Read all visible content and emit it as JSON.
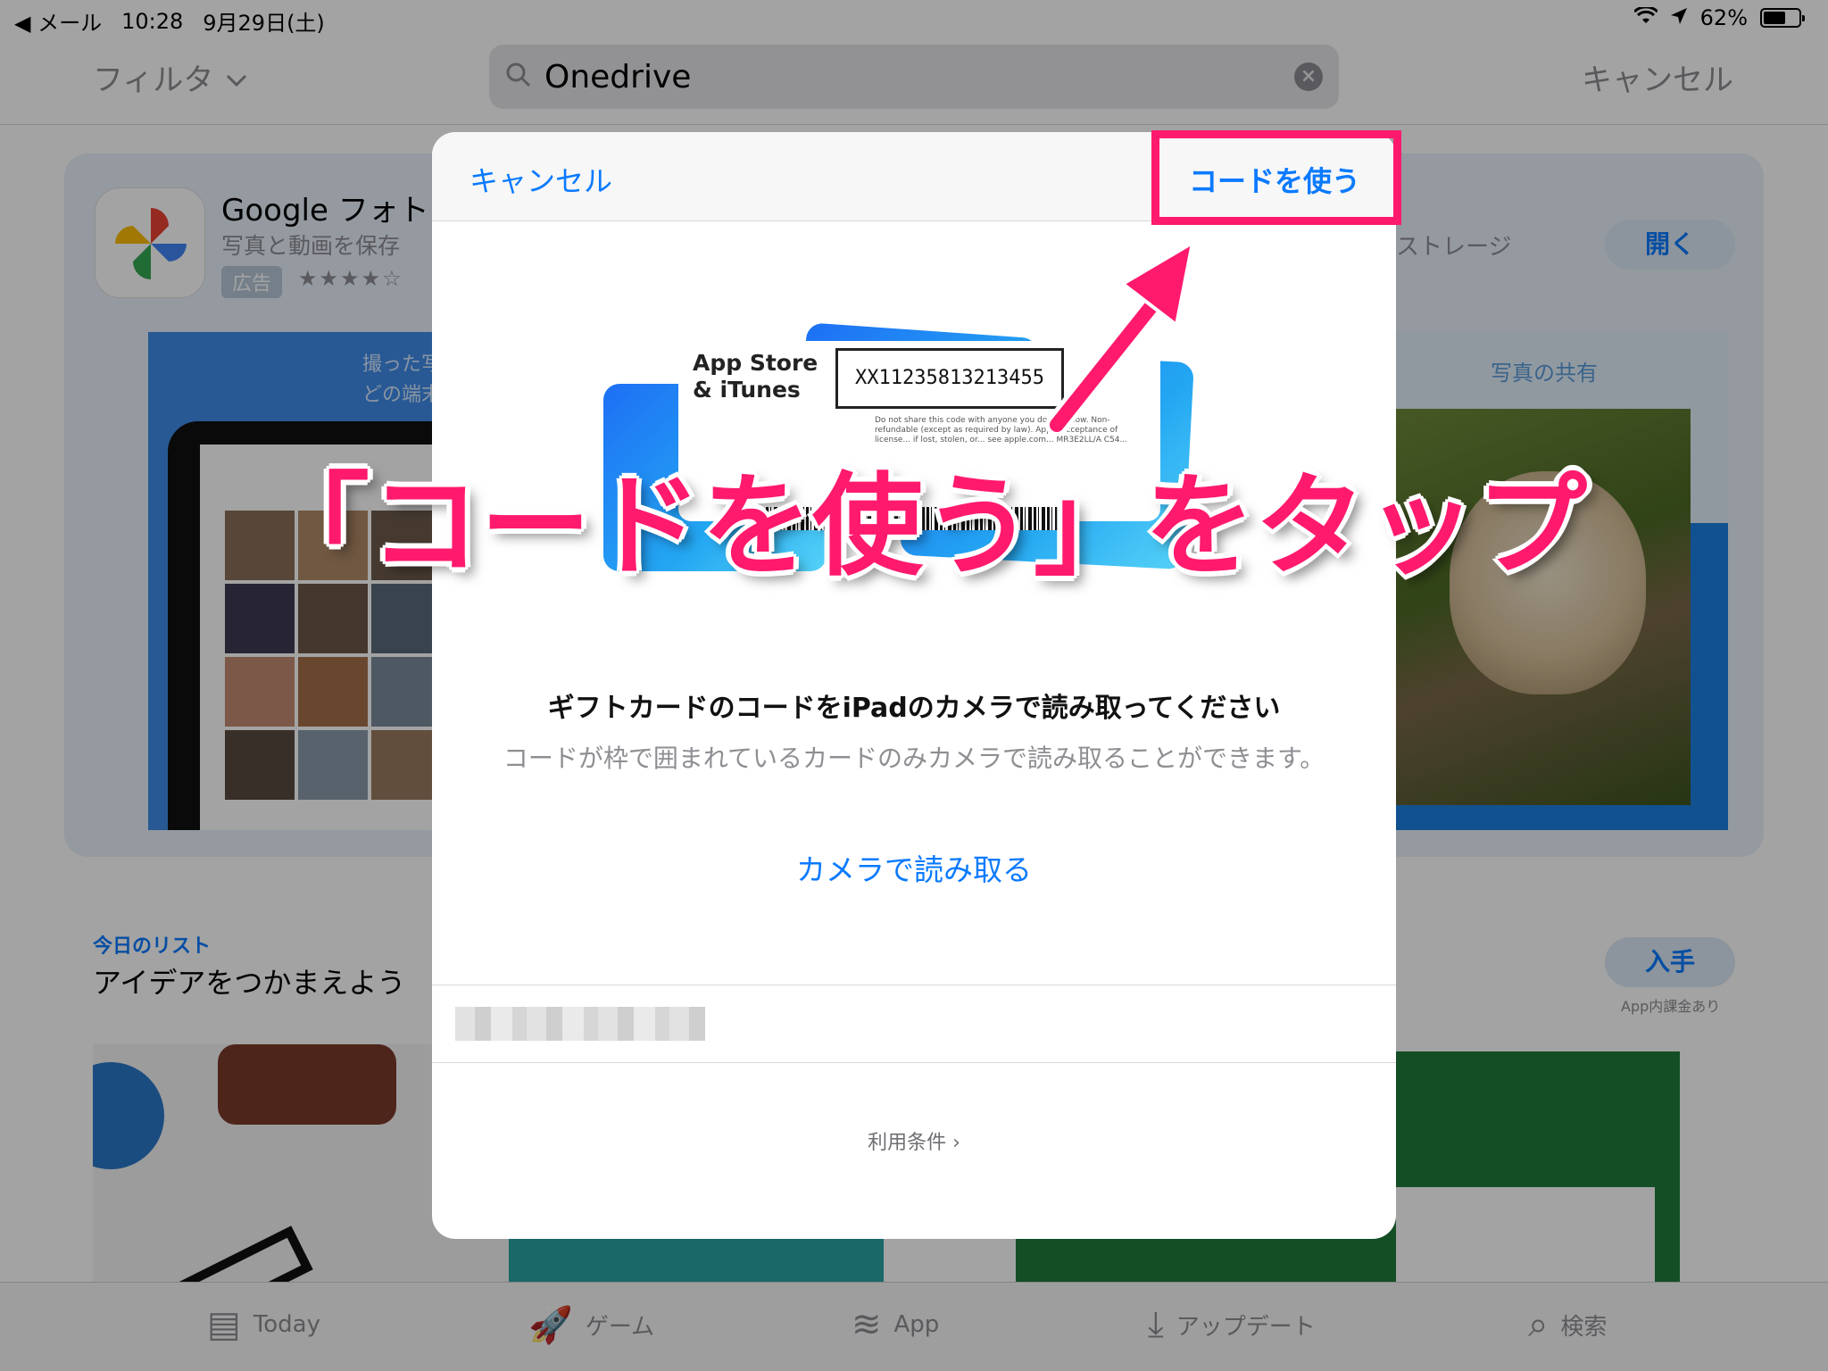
{
  "status_bar": {
    "back_app": "◀ メール",
    "time": "10:28",
    "date": "9月29日(土)",
    "battery": "62%",
    "battery_level": 0.62
  },
  "nav": {
    "filter_label": "フィルタ",
    "search_query": "Onedrive",
    "cancel_label": "キャンセル"
  },
  "background": {
    "ad_app": {
      "name": "Google フォト",
      "subtitle": "写真と動画を保存",
      "ad_badge": "広告",
      "stars": "★★★★☆",
      "storage_text": "ストレージ",
      "open_label": "開く",
      "screenshot_left_caption": "撮った写\nどの端末",
      "screenshot_right_caption": "写真の共有"
    },
    "today_list": {
      "label": "今日のリスト",
      "title": "アイデアをつかまえよう",
      "get_label": "入手",
      "iap_note": "App内課金あり"
    }
  },
  "tab_bar": {
    "items": [
      {
        "label": "Today",
        "icon": "today-icon"
      },
      {
        "label": "ゲーム",
        "icon": "rocket-icon"
      },
      {
        "label": "App",
        "icon": "layers-icon"
      },
      {
        "label": "アップデート",
        "icon": "download-icon"
      },
      {
        "label": "検索",
        "icon": "search-icon"
      }
    ]
  },
  "modal": {
    "cancel_label": "キャンセル",
    "use_code_label": "コードを使う",
    "gift_card": {
      "brand": "App Store\n& iTunes",
      "code": "XX11235813213455",
      "fine_print": "Do not share this code with anyone you do not know. Non-refundable (except as required by law). Apple acceptance of license... if lost, stolen, or... see apple.com... MR3E2LL/A C54..."
    },
    "caption_title": "ギフトカードのコードをiPadのカメラで読み取ってください",
    "caption_sub": "コードが枠で囲まれているカードのみカメラで読み取ることができます。",
    "camera_link": "カメラで読み取る",
    "terms_label": "利用条件"
  },
  "annotation": {
    "text": "「コードを使う」をタップ",
    "color": "#ff1a6e"
  },
  "colors": {
    "ios_blue": "#0a7aff",
    "annotation_pink": "#ff1a6e"
  }
}
